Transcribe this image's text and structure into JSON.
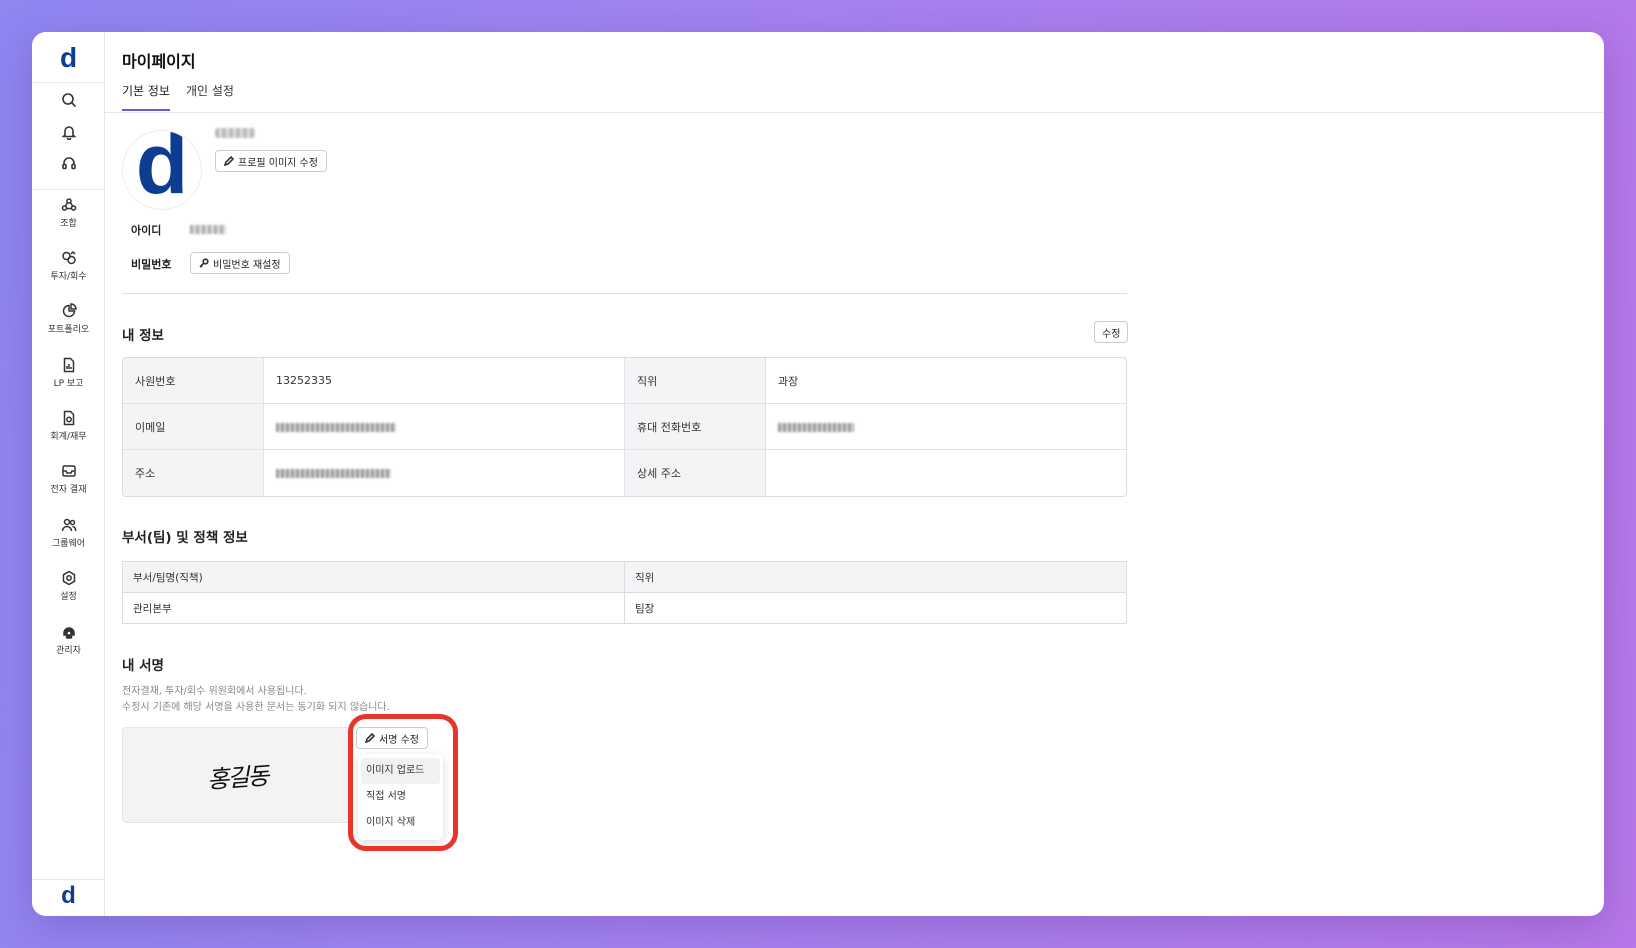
{
  "app": {
    "logo_text": "d",
    "brand_color": "#0d3d91",
    "accent_color": "#6c5bd4",
    "highlight_color": "#e8342b"
  },
  "sidebar": {
    "quick_icons": [
      "search-icon",
      "bell-icon",
      "headset-icon"
    ],
    "items": [
      {
        "label": "조합",
        "icon": "union-icon"
      },
      {
        "label": "투자/회수",
        "icon": "investment-icon"
      },
      {
        "label": "포트폴리오",
        "icon": "pie-chart-icon"
      },
      {
        "label": "LP 보고",
        "icon": "report-icon"
      },
      {
        "label": "회계/재무",
        "icon": "finance-icon"
      },
      {
        "label": "전자 결재",
        "icon": "approval-icon"
      },
      {
        "label": "그룹웨어",
        "icon": "groupware-icon"
      },
      {
        "label": "설정",
        "icon": "settings-icon"
      },
      {
        "label": "관리자",
        "icon": "admin-icon"
      }
    ]
  },
  "page": {
    "title": "마이페이지",
    "tabs": [
      {
        "label": "기본 정보",
        "active": true
      },
      {
        "label": "개인 설정",
        "active": false
      }
    ]
  },
  "profile": {
    "avatar_text": "d",
    "edit_photo_label": "프로필 이미지 수정",
    "id_label": "아이디",
    "password_label": "비밀번호",
    "password_reset_label": "비밀번호 재설정"
  },
  "my_info": {
    "title": "내 정보",
    "edit_label": "수정",
    "rows": [
      {
        "label1": "사원번호",
        "value1": "13252335",
        "label2": "직위",
        "value2": "과장"
      },
      {
        "label1": "이메일",
        "value1": "",
        "label2": "휴대 전화번호",
        "value2": ""
      },
      {
        "label1": "주소",
        "value1": "",
        "label2": "상세 주소",
        "value2": ""
      }
    ]
  },
  "dept": {
    "title": "부서(팀) 및 정책 정보",
    "headers": [
      "부서/팀명(직책)",
      "직위"
    ],
    "rows": [
      [
        "관리본부",
        "팀장"
      ]
    ]
  },
  "signature": {
    "title": "내 서명",
    "note_line1": "전자결재, 투자/회수 위원회에서 사용됩니다.",
    "note_line2": "수정시 기존에 해당 서명을 사용한 문서는 동기화 되지 않습니다.",
    "signature_text": "홍길동",
    "edit_label": "서명 수정",
    "menu": [
      "이미지 업로드",
      "직접 서명",
      "이미지 삭제"
    ]
  }
}
